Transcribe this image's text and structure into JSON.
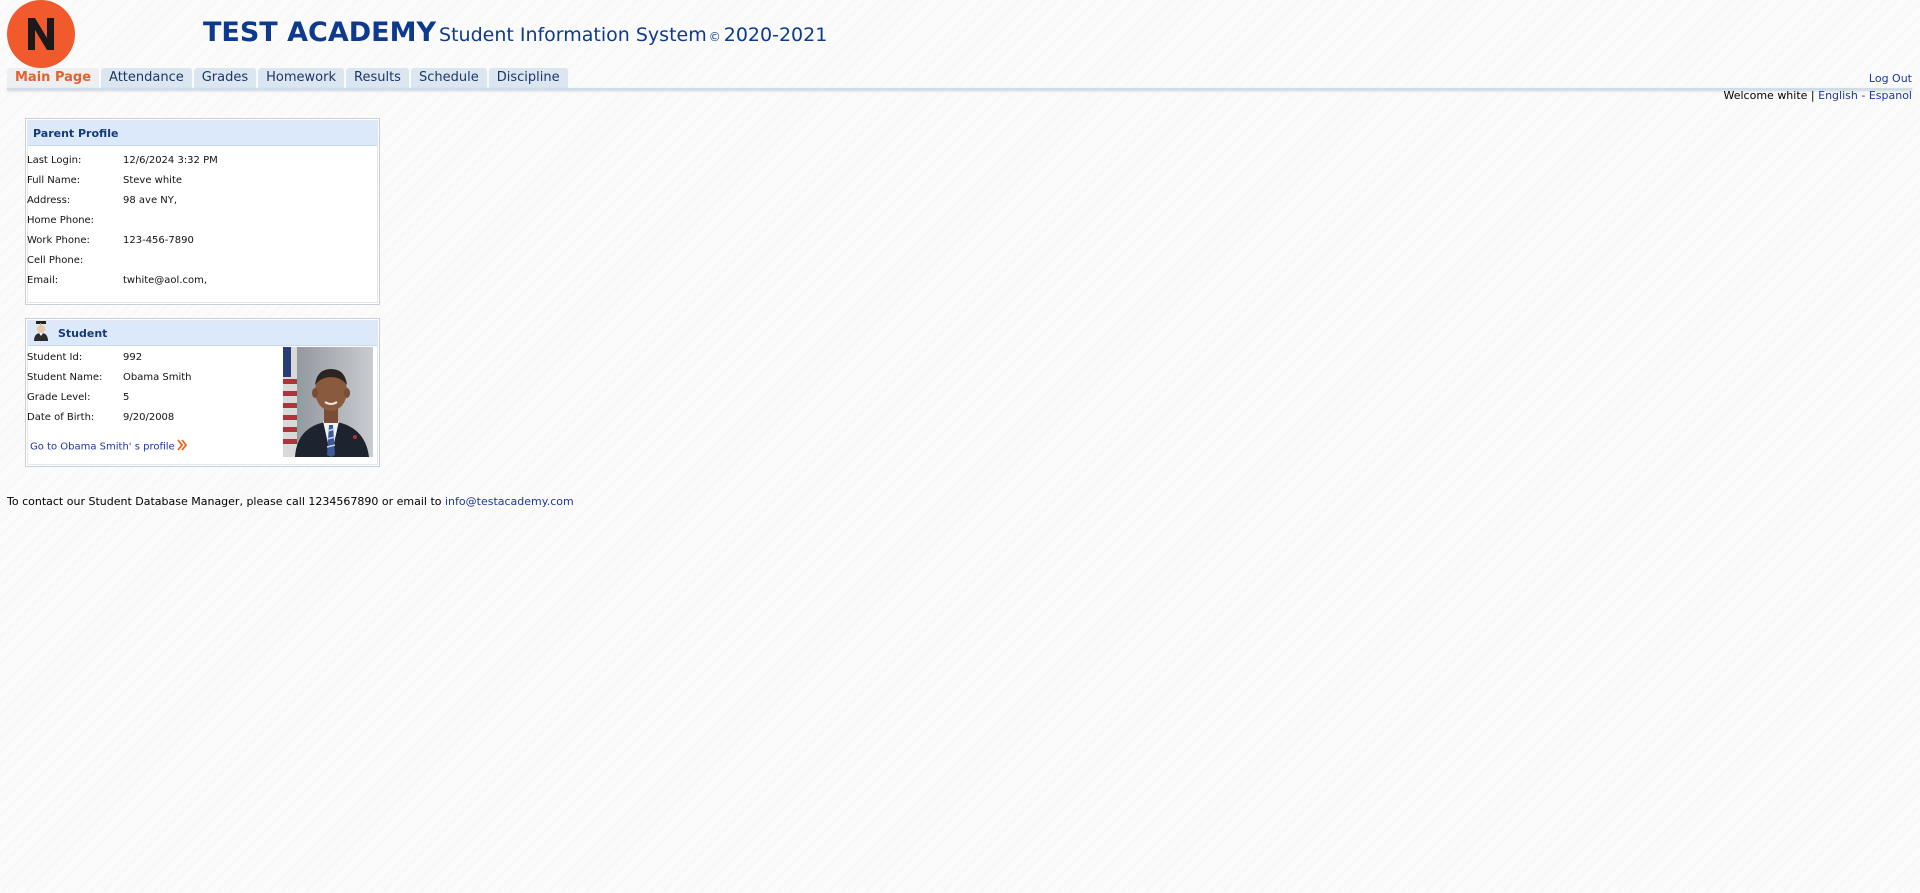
{
  "header": {
    "school_name": "TEST ACADEMY",
    "system_name": "Student Information System",
    "copyright_symbol": "©",
    "years": "2020-2021",
    "logo_icon": "school-logo-icon",
    "logo_color": "#f05a2c"
  },
  "tabs": [
    {
      "label": "Main Page",
      "active": true
    },
    {
      "label": "Attendance",
      "active": false
    },
    {
      "label": "Grades",
      "active": false
    },
    {
      "label": "Homework",
      "active": false
    },
    {
      "label": "Results",
      "active": false
    },
    {
      "label": "Schedule",
      "active": false
    },
    {
      "label": "Discipline",
      "active": false
    }
  ],
  "session": {
    "logout_label": "Log Out",
    "welcome_text": "Welcome white",
    "separator": " | ",
    "lang_english": "English",
    "lang_dash": " - ",
    "lang_spanish": "Espanol"
  },
  "parent_profile": {
    "title": "Parent Profile",
    "fields": [
      {
        "label": "Last Login:",
        "value": "12/6/2024 3:32 PM"
      },
      {
        "label": "Full Name:",
        "value": "Steve white"
      },
      {
        "label": "Address:",
        "value": "98 ave NY,"
      },
      {
        "label": "Home Phone:",
        "value": ""
      },
      {
        "label": "Work Phone:",
        "value": "123-456-7890"
      },
      {
        "label": "Cell Phone:",
        "value": ""
      },
      {
        "label": "Email:",
        "value": "twhite@aol.com,"
      }
    ]
  },
  "student": {
    "title": "Student",
    "icon": "graduate-icon",
    "fields": [
      {
        "label": "Student Id:",
        "value": "992"
      },
      {
        "label": "Student Name:",
        "value": "Obama Smith"
      },
      {
        "label": "Grade Level:",
        "value": "5"
      },
      {
        "label": "Date of Birth:",
        "value": "9/20/2008"
      }
    ],
    "profile_link": "Go to Obama Smith' s profile",
    "profile_link_icon": "double-chevron-right-icon",
    "photo_icon": "student-photo"
  },
  "footer": {
    "contact_text": "To contact our Student Database Manager, please call 1234567890 or email to ",
    "contact_email": "info@testacademy.com"
  },
  "colors": {
    "brand_blue": "#0d3a8c",
    "active_tab": "#e2622d",
    "link_blue": "#1e34a0",
    "panel_header": "#dce9fb"
  }
}
